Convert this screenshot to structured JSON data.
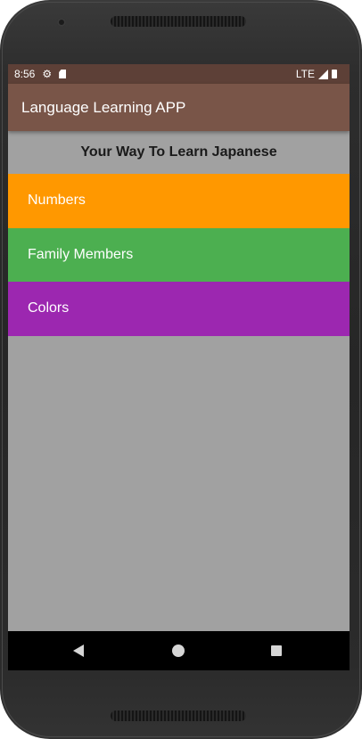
{
  "status_bar": {
    "time": "8:56",
    "network": "LTE",
    "icons": [
      "gear-icon",
      "sd-card-icon",
      "signal-icon",
      "battery-icon"
    ]
  },
  "app_bar": {
    "title": "Language Learning APP"
  },
  "main": {
    "subtitle": "Your Way To Learn Japanese",
    "categories": [
      {
        "label": "Numbers",
        "color": "#ff9800"
      },
      {
        "label": "Family Members",
        "color": "#4caf50"
      },
      {
        "label": "Colors",
        "color": "#9c27b0"
      }
    ]
  },
  "nav_bar": {
    "icons": [
      "back-icon",
      "home-icon",
      "recents-icon"
    ]
  },
  "colors": {
    "status_bar": "#5d4037",
    "app_bar": "#795548",
    "background": "#a1a1a1"
  }
}
